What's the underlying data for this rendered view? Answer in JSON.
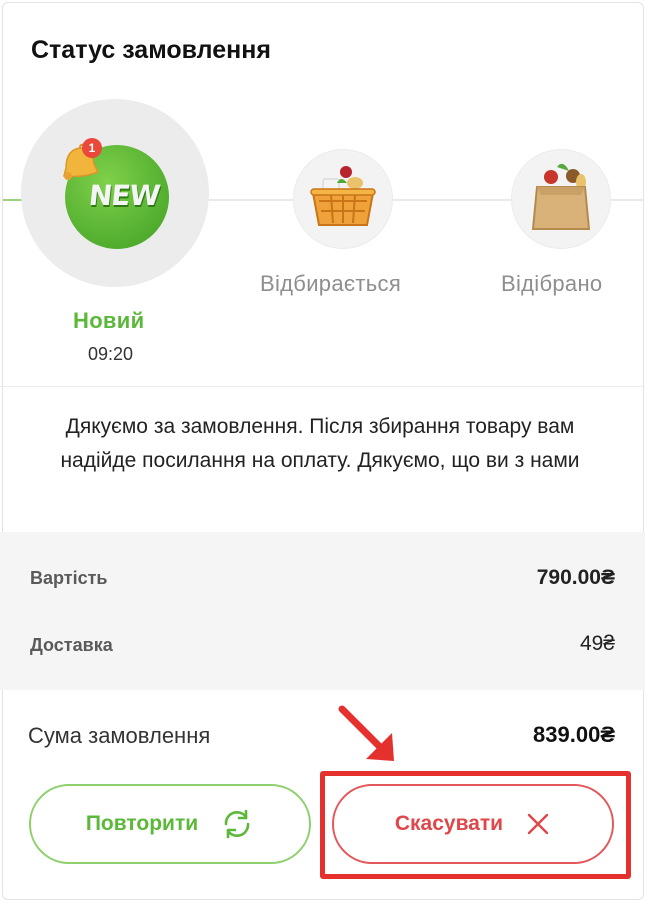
{
  "title": "Статус замовлення",
  "stages": [
    {
      "label": "Новий",
      "time": "09:20",
      "icon": "new-badge-bell-icon",
      "badge": "1",
      "status": "active"
    },
    {
      "label": "Відбирається",
      "icon": "grocery-basket-icon",
      "status": "pending"
    },
    {
      "label": "Відібрано",
      "icon": "grocery-bag-icon",
      "status": "pending"
    }
  ],
  "new_text": "NEW",
  "message": "Дякуємо за замовлення. Після збирання товару вам надійде посилання на оплату. Дякуємо, що ви з нами",
  "summary": {
    "cost_label": "Вартість",
    "cost_value": "790.00₴",
    "delivery_label": "Доставка",
    "delivery_value": "49₴"
  },
  "total": {
    "label": "Сума замовлення",
    "value": "839.00₴"
  },
  "buttons": {
    "repeat": {
      "label": "Повторити",
      "icon": "refresh-icon"
    },
    "cancel": {
      "label": "Скасувати",
      "icon": "close-icon"
    }
  },
  "colors": {
    "accent_green": "#5cb83a",
    "cancel_red": "#e0474b",
    "annotation_red": "#e5312d"
  }
}
